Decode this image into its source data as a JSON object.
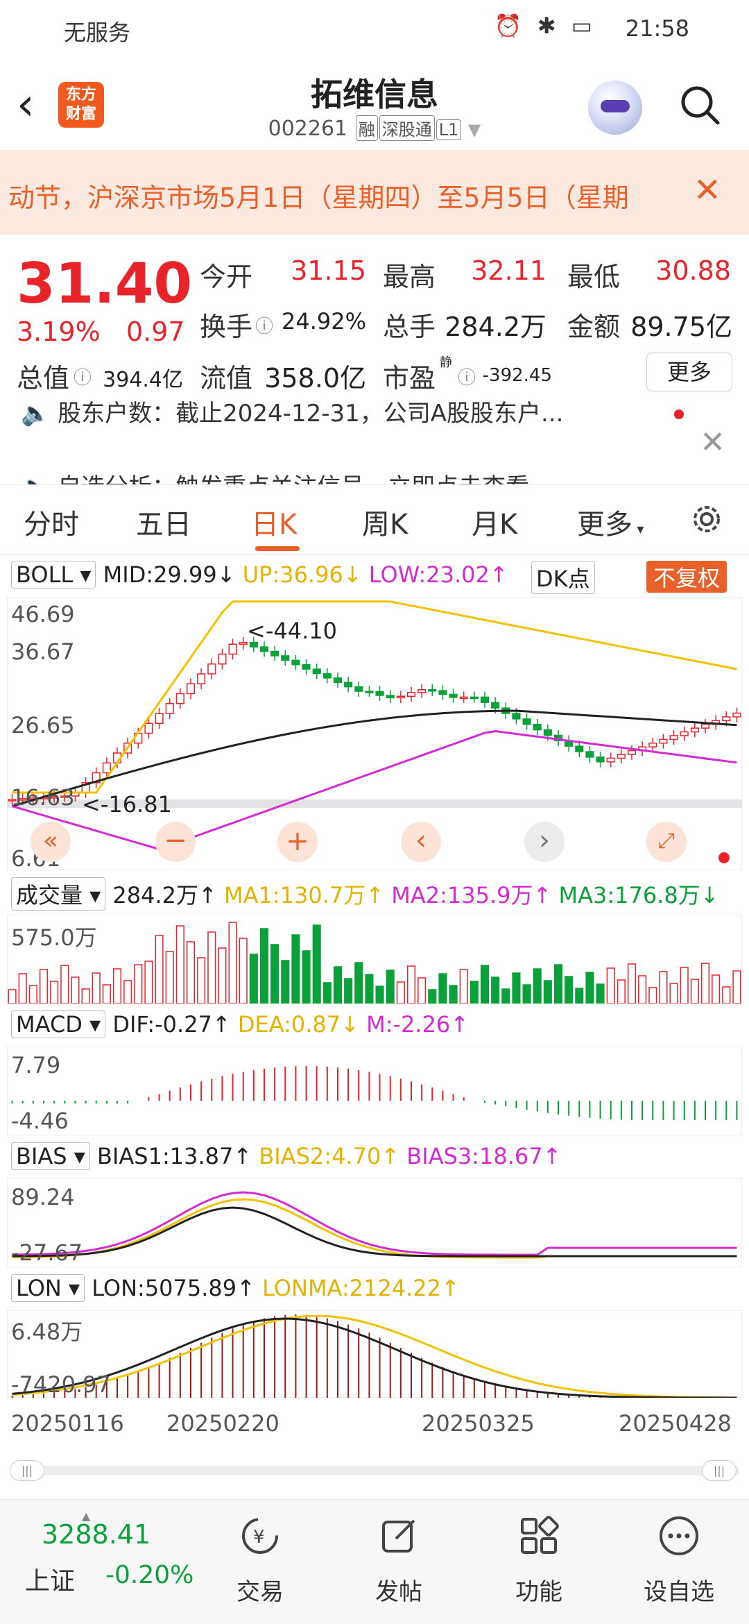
{
  "status": {
    "network": "无服务",
    "time": "21:58"
  },
  "header": {
    "title": "拓维信息",
    "code": "002261",
    "tags": [
      "融",
      "深股通",
      "L1"
    ],
    "logo": "东方\n财富"
  },
  "notice": {
    "text": "动节，沪深京市场5月1日（星期四）至5月5日（星期"
  },
  "quote": {
    "price": "31.40",
    "pct": "3.19%",
    "chg": "0.97",
    "open_label": "今开",
    "open": "31.15",
    "high_label": "最高",
    "high": "32.11",
    "low_label": "最低",
    "low": "30.88",
    "turnover_label": "换手",
    "turnover": "24.92%",
    "vol_label": "总手",
    "vol": "284.2万",
    "amount_label": "金额",
    "amount": "89.75亿",
    "mcap_label": "总值",
    "mcap": "394.4亿",
    "float_label": "流值",
    "float": "358.0亿",
    "pe_label": "市盈",
    "pe_sup": "静",
    "pe": "-392.45",
    "more": "更多"
  },
  "news": {
    "row1": "股东户数：截止2024-12-31，公司A股股东户...",
    "row2": "自选分析：触发重点关注信号，立即点击查看"
  },
  "tabs": [
    "分时",
    "五日",
    "日K",
    "周K",
    "月K",
    "更多"
  ],
  "active_tab": "日K",
  "chart": {
    "boll": {
      "name": "BOLL",
      "mid": "MID:29.99↓",
      "up": "UP:36.96↓",
      "low": "LOW:23.02↑"
    },
    "dk": "DK点",
    "fq": "不复权",
    "yticks": [
      "46.69",
      "36.67",
      "26.65",
      "16.63",
      "6.61"
    ],
    "max_label": "<-44.10",
    "min_label": "<-16.81",
    "vol": {
      "name": "成交量",
      "v": "284.2万↑",
      "ma1": "MA1:130.7万↑",
      "ma2": "MA2:135.9万↑",
      "ma3": "MA3:176.8万↓",
      "ytop": "575.0万"
    },
    "macd": {
      "name": "MACD",
      "dif": "DIF:-0.27↑",
      "dea": "DEA:0.87↓",
      "m": "M:-2.26↑",
      "ytop": "7.79",
      "ybot": "-4.46"
    },
    "bias": {
      "name": "BIAS",
      "b1": "BIAS1:13.87↑",
      "b2": "BIAS2:4.70↑",
      "b3": "BIAS3:18.67↑",
      "ytop": "89.24",
      "ybot": "-27.67"
    },
    "lon": {
      "name": "LON",
      "lon": "LON:5075.89↑",
      "lonma": "LONMA:2124.22↑",
      "ytop": "6.48万",
      "ybot": "-7420.97"
    },
    "dates": [
      "20250116",
      "20250220",
      "20250325",
      "20250428"
    ]
  },
  "bottom": {
    "index_value": "3288.41",
    "index_name": "上证",
    "index_pct": "-0.20%",
    "items": [
      "交易",
      "发帖",
      "功能",
      "设自选"
    ]
  },
  "colors": {
    "up": "#e8232a",
    "down": "#0aa13a",
    "accent": "#e8612a",
    "yellow": "#f2c200",
    "magenta": "#d42ad4"
  }
}
